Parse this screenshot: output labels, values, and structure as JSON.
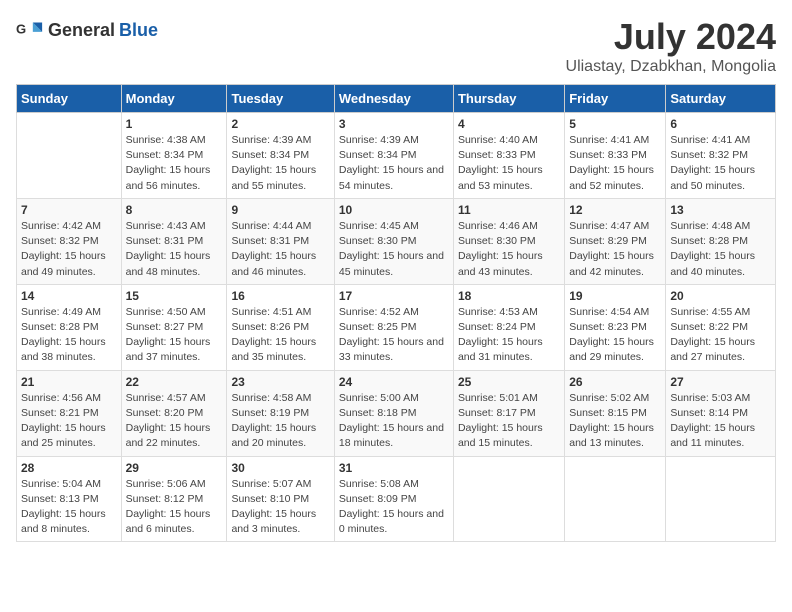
{
  "header": {
    "logo_general": "General",
    "logo_blue": "Blue",
    "title": "July 2024",
    "subtitle": "Uliastay, Dzabkhan, Mongolia"
  },
  "days_of_week": [
    "Sunday",
    "Monday",
    "Tuesday",
    "Wednesday",
    "Thursday",
    "Friday",
    "Saturday"
  ],
  "weeks": [
    [
      {
        "num": "",
        "sunrise": "",
        "sunset": "",
        "daylight": ""
      },
      {
        "num": "1",
        "sunrise": "Sunrise: 4:38 AM",
        "sunset": "Sunset: 8:34 PM",
        "daylight": "Daylight: 15 hours and 56 minutes."
      },
      {
        "num": "2",
        "sunrise": "Sunrise: 4:39 AM",
        "sunset": "Sunset: 8:34 PM",
        "daylight": "Daylight: 15 hours and 55 minutes."
      },
      {
        "num": "3",
        "sunrise": "Sunrise: 4:39 AM",
        "sunset": "Sunset: 8:34 PM",
        "daylight": "Daylight: 15 hours and 54 minutes."
      },
      {
        "num": "4",
        "sunrise": "Sunrise: 4:40 AM",
        "sunset": "Sunset: 8:33 PM",
        "daylight": "Daylight: 15 hours and 53 minutes."
      },
      {
        "num": "5",
        "sunrise": "Sunrise: 4:41 AM",
        "sunset": "Sunset: 8:33 PM",
        "daylight": "Daylight: 15 hours and 52 minutes."
      },
      {
        "num": "6",
        "sunrise": "Sunrise: 4:41 AM",
        "sunset": "Sunset: 8:32 PM",
        "daylight": "Daylight: 15 hours and 50 minutes."
      }
    ],
    [
      {
        "num": "7",
        "sunrise": "Sunrise: 4:42 AM",
        "sunset": "Sunset: 8:32 PM",
        "daylight": "Daylight: 15 hours and 49 minutes."
      },
      {
        "num": "8",
        "sunrise": "Sunrise: 4:43 AM",
        "sunset": "Sunset: 8:31 PM",
        "daylight": "Daylight: 15 hours and 48 minutes."
      },
      {
        "num": "9",
        "sunrise": "Sunrise: 4:44 AM",
        "sunset": "Sunset: 8:31 PM",
        "daylight": "Daylight: 15 hours and 46 minutes."
      },
      {
        "num": "10",
        "sunrise": "Sunrise: 4:45 AM",
        "sunset": "Sunset: 8:30 PM",
        "daylight": "Daylight: 15 hours and 45 minutes."
      },
      {
        "num": "11",
        "sunrise": "Sunrise: 4:46 AM",
        "sunset": "Sunset: 8:30 PM",
        "daylight": "Daylight: 15 hours and 43 minutes."
      },
      {
        "num": "12",
        "sunrise": "Sunrise: 4:47 AM",
        "sunset": "Sunset: 8:29 PM",
        "daylight": "Daylight: 15 hours and 42 minutes."
      },
      {
        "num": "13",
        "sunrise": "Sunrise: 4:48 AM",
        "sunset": "Sunset: 8:28 PM",
        "daylight": "Daylight: 15 hours and 40 minutes."
      }
    ],
    [
      {
        "num": "14",
        "sunrise": "Sunrise: 4:49 AM",
        "sunset": "Sunset: 8:28 PM",
        "daylight": "Daylight: 15 hours and 38 minutes."
      },
      {
        "num": "15",
        "sunrise": "Sunrise: 4:50 AM",
        "sunset": "Sunset: 8:27 PM",
        "daylight": "Daylight: 15 hours and 37 minutes."
      },
      {
        "num": "16",
        "sunrise": "Sunrise: 4:51 AM",
        "sunset": "Sunset: 8:26 PM",
        "daylight": "Daylight: 15 hours and 35 minutes."
      },
      {
        "num": "17",
        "sunrise": "Sunrise: 4:52 AM",
        "sunset": "Sunset: 8:25 PM",
        "daylight": "Daylight: 15 hours and 33 minutes."
      },
      {
        "num": "18",
        "sunrise": "Sunrise: 4:53 AM",
        "sunset": "Sunset: 8:24 PM",
        "daylight": "Daylight: 15 hours and 31 minutes."
      },
      {
        "num": "19",
        "sunrise": "Sunrise: 4:54 AM",
        "sunset": "Sunset: 8:23 PM",
        "daylight": "Daylight: 15 hours and 29 minutes."
      },
      {
        "num": "20",
        "sunrise": "Sunrise: 4:55 AM",
        "sunset": "Sunset: 8:22 PM",
        "daylight": "Daylight: 15 hours and 27 minutes."
      }
    ],
    [
      {
        "num": "21",
        "sunrise": "Sunrise: 4:56 AM",
        "sunset": "Sunset: 8:21 PM",
        "daylight": "Daylight: 15 hours and 25 minutes."
      },
      {
        "num": "22",
        "sunrise": "Sunrise: 4:57 AM",
        "sunset": "Sunset: 8:20 PM",
        "daylight": "Daylight: 15 hours and 22 minutes."
      },
      {
        "num": "23",
        "sunrise": "Sunrise: 4:58 AM",
        "sunset": "Sunset: 8:19 PM",
        "daylight": "Daylight: 15 hours and 20 minutes."
      },
      {
        "num": "24",
        "sunrise": "Sunrise: 5:00 AM",
        "sunset": "Sunset: 8:18 PM",
        "daylight": "Daylight: 15 hours and 18 minutes."
      },
      {
        "num": "25",
        "sunrise": "Sunrise: 5:01 AM",
        "sunset": "Sunset: 8:17 PM",
        "daylight": "Daylight: 15 hours and 15 minutes."
      },
      {
        "num": "26",
        "sunrise": "Sunrise: 5:02 AM",
        "sunset": "Sunset: 8:15 PM",
        "daylight": "Daylight: 15 hours and 13 minutes."
      },
      {
        "num": "27",
        "sunrise": "Sunrise: 5:03 AM",
        "sunset": "Sunset: 8:14 PM",
        "daylight": "Daylight: 15 hours and 11 minutes."
      }
    ],
    [
      {
        "num": "28",
        "sunrise": "Sunrise: 5:04 AM",
        "sunset": "Sunset: 8:13 PM",
        "daylight": "Daylight: 15 hours and 8 minutes."
      },
      {
        "num": "29",
        "sunrise": "Sunrise: 5:06 AM",
        "sunset": "Sunset: 8:12 PM",
        "daylight": "Daylight: 15 hours and 6 minutes."
      },
      {
        "num": "30",
        "sunrise": "Sunrise: 5:07 AM",
        "sunset": "Sunset: 8:10 PM",
        "daylight": "Daylight: 15 hours and 3 minutes."
      },
      {
        "num": "31",
        "sunrise": "Sunrise: 5:08 AM",
        "sunset": "Sunset: 8:09 PM",
        "daylight": "Daylight: 15 hours and 0 minutes."
      },
      {
        "num": "",
        "sunrise": "",
        "sunset": "",
        "daylight": ""
      },
      {
        "num": "",
        "sunrise": "",
        "sunset": "",
        "daylight": ""
      },
      {
        "num": "",
        "sunrise": "",
        "sunset": "",
        "daylight": ""
      }
    ]
  ]
}
